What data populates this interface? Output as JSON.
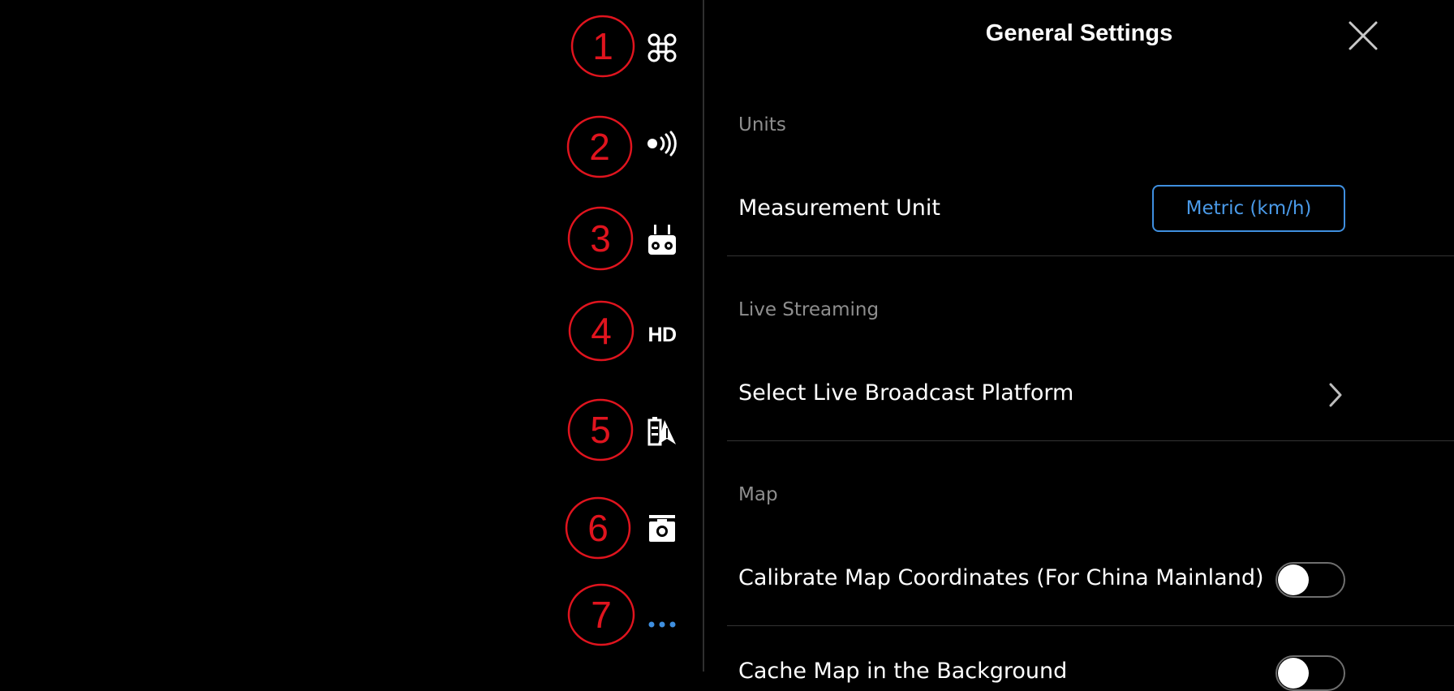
{
  "nav": {
    "items": [
      {
        "id": "aircraft",
        "icon": "drone-icon"
      },
      {
        "id": "signal",
        "icon": "signal-icon"
      },
      {
        "id": "remote",
        "icon": "remote-controller-icon"
      },
      {
        "id": "hd",
        "icon": "hd-icon",
        "text": "HD"
      },
      {
        "id": "battery-nav",
        "icon": "battery-navigation-icon"
      },
      {
        "id": "camera",
        "icon": "camera-icon"
      },
      {
        "id": "more",
        "icon": "more-icon"
      }
    ],
    "markers": [
      "1",
      "2",
      "3",
      "4",
      "5",
      "6",
      "7"
    ],
    "marker_color": "#e0141e",
    "more_color": "#3f8fdf"
  },
  "panel": {
    "title": "General Settings",
    "sections": {
      "units": {
        "label": "Units",
        "measurement_label": "Measurement Unit",
        "measurement_value": "Metric (km/h)"
      },
      "live": {
        "label": "Live Streaming",
        "platform_label": "Select Live Broadcast Platform"
      },
      "map": {
        "label": "Map",
        "calibrate_label": "Calibrate Map Coordinates (For China Mainland)",
        "calibrate_on": false,
        "cache_label": "Cache Map in the Background",
        "cache_on": false
      }
    }
  },
  "colors": {
    "accent": "#3f8fdf",
    "background": "#000000",
    "section_text": "#8e8e8e"
  }
}
